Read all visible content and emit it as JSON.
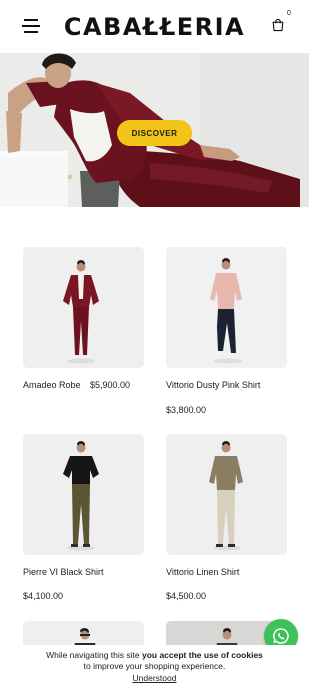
{
  "header": {
    "logo": "CABAŁŁERIA",
    "cart_count": "0",
    "icons": [
      "menu-icon",
      "shopping-bag-icon"
    ]
  },
  "hero": {
    "button_label": "DISCOVER",
    "colors": {
      "button": "#f2c318",
      "garment": "#6e1420"
    }
  },
  "products": [
    {
      "name": "Amadeo Robe",
      "price": "$5,900.00"
    },
    {
      "name": "Vittorio Dusty Pink Shirt",
      "price": "$3,800.00"
    },
    {
      "name": "Pierre VI Black Shirt",
      "price": "$4,100.00"
    },
    {
      "name": "Vittorio Linen Shirt",
      "price": "$4,500.00"
    }
  ],
  "cookie": {
    "text_before": "While navigating this site ",
    "text_bold": "you accept the use of cookies",
    "text_after": "to improve your shopping experience.",
    "button": "Understood"
  },
  "whatsapp": {
    "icon": "whatsapp-icon",
    "color": "#3ec158"
  }
}
